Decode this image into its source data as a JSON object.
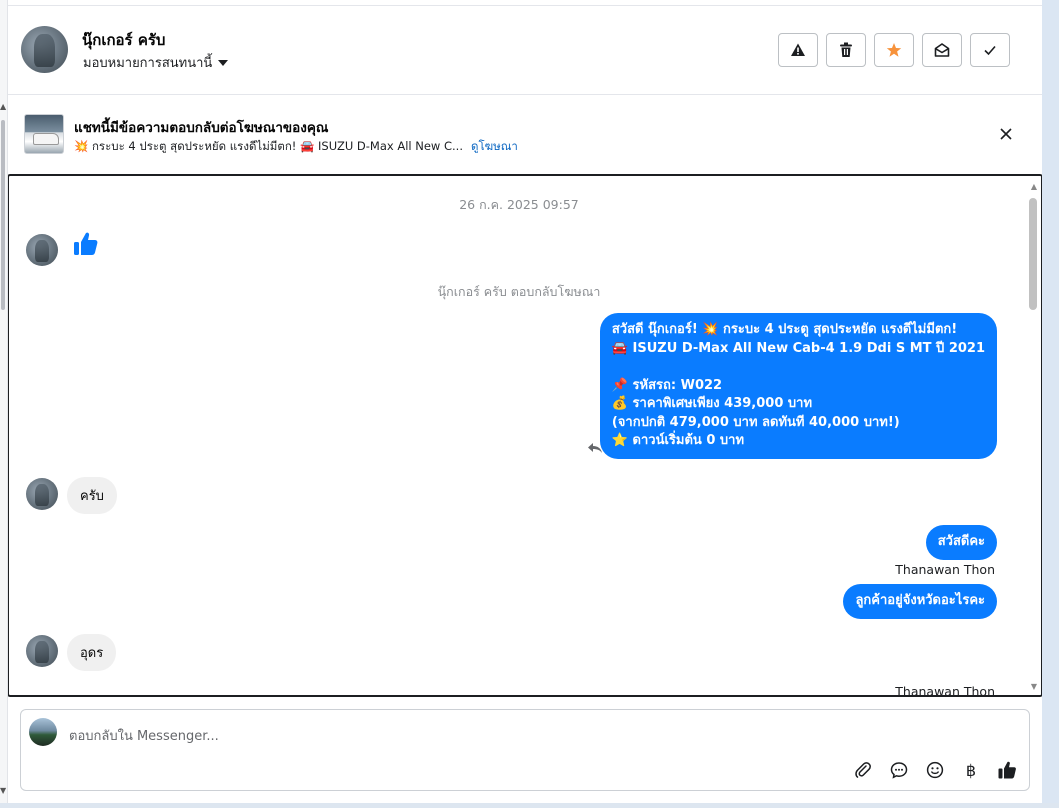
{
  "header": {
    "contact_name": "นุ๊กเกอร์ ครับ",
    "assign_label": "มอบหมายการสนทนานี้",
    "actions": [
      {
        "name": "report-icon"
      },
      {
        "name": "trash-icon"
      },
      {
        "name": "star-icon",
        "color": "#f7923b"
      },
      {
        "name": "mark-unread-icon"
      },
      {
        "name": "done-check-icon"
      }
    ]
  },
  "ad_banner": {
    "title": "แชทนี้มีข้อความตอบกลับต่อโฆษณาของคุณ",
    "ad_text": "💥 กระบะ 4 ประตู สุดประหยัด แรงดีไม่มีตก! 🚘 ISUZU D-Max All New C...",
    "view_ad_link": "ดูโฆษณา"
  },
  "conversation": {
    "timestamp": "26 ก.ค. 2025 09:57",
    "ad_reply_notice": "นุ๊กเกอร์ ครับ ตอบกลับโฆษณา",
    "outgoing_ad_message": [
      "สวัสดี นุ๊กเกอร์! 💥 กระบะ 4 ประตู สุดประหยัด แรงดีไม่มีตก!",
      "🚘 ISUZU D-Max All New Cab-4 1.9 Ddi S MT ปี 2021",
      "",
      "📌 รหัสรถ: W022",
      "💰 ราคาพิเศษเพียง 439,000 บาท",
      "(จากปกติ 479,000 บาท ลดทันที 40,000 บาท!)",
      "⭐ ดาวน์เริ่มต้น 0 บาท"
    ],
    "incoming_1": "ครับ",
    "outgoing_2": "สวัสดีคะ",
    "sender_2": "Thanawan Thon",
    "outgoing_3": "ลูกค้าอยู่จังหวัดอะไรคะ",
    "incoming_2": "อุดร",
    "sender_3": "Thanawan Thon"
  },
  "composer": {
    "placeholder": "ตอบกลับใน Messenger...",
    "tools": [
      "attach-icon",
      "saved-reply-icon",
      "emoji-icon",
      "baht-icon",
      "like-icon"
    ],
    "baht_symbol": "฿"
  },
  "colors": {
    "outgoing_bubble": "#0a7cff",
    "incoming_bubble": "#f0f0f0",
    "link": "#0a66c2",
    "star": "#f7923b"
  }
}
